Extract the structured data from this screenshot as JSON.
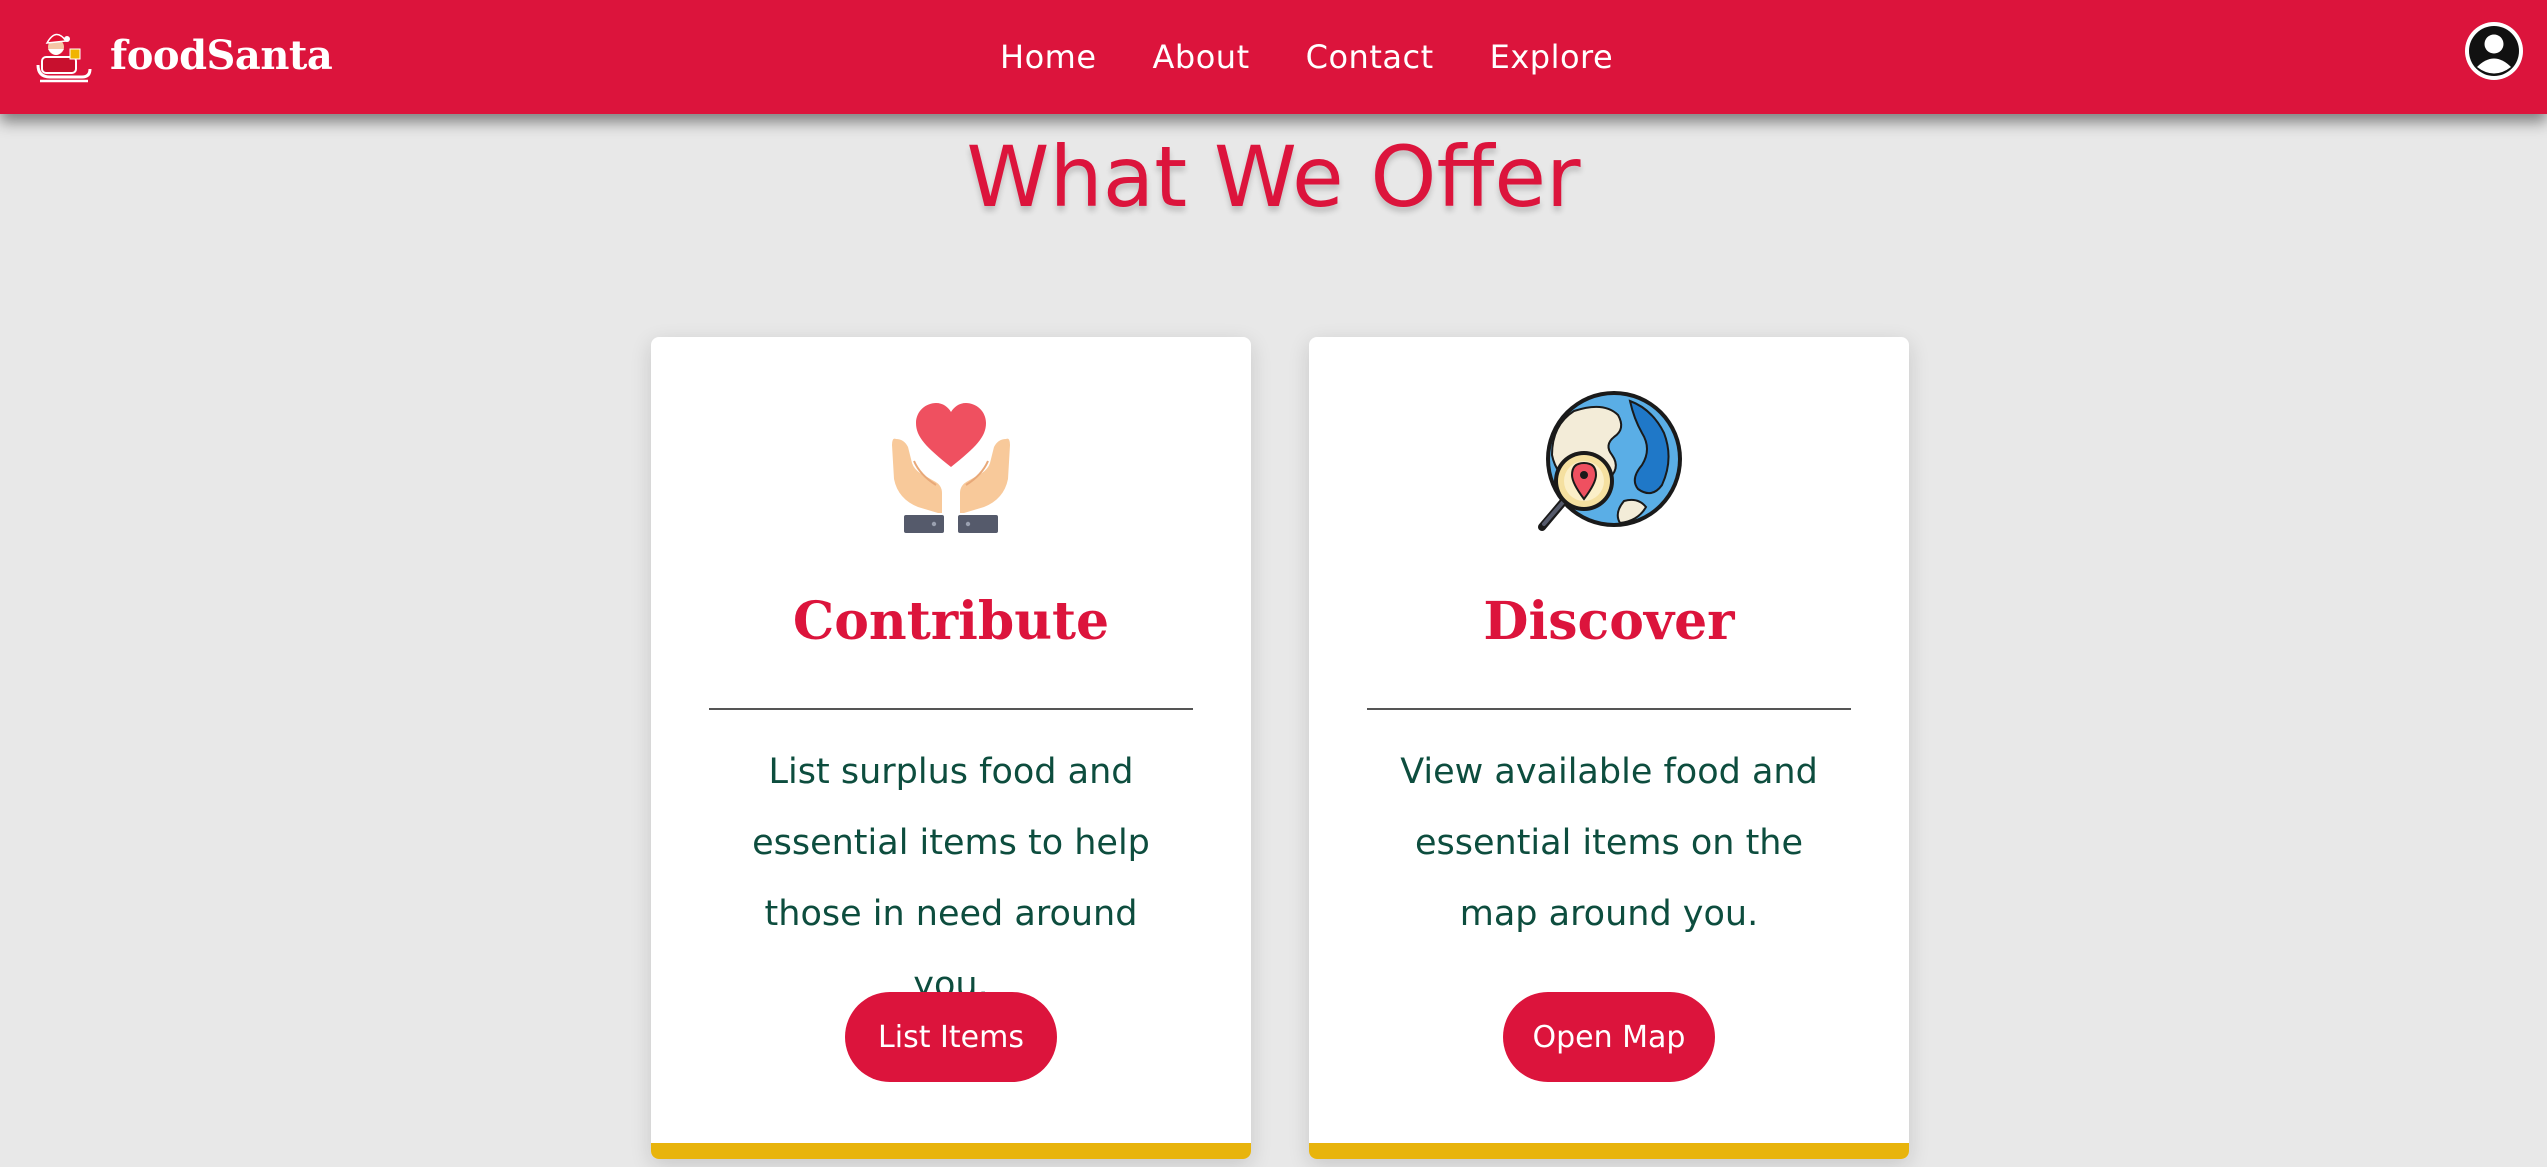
{
  "navbar": {
    "brand_name": "foodSanta",
    "logo_icon": "santa-sleigh-logo",
    "links": [
      "Home",
      "About",
      "Contact",
      "Explore"
    ],
    "profile_icon": "user-circle-icon"
  },
  "main": {
    "title": "What We Offer",
    "cards": [
      {
        "icon": "hands-heart-icon",
        "title": "Contribute",
        "text": "List surplus food and essential items to help those in need around you.",
        "button_label": "List Items"
      },
      {
        "icon": "globe-search-icon",
        "title": "Discover",
        "text": "View available food and essential items on the map around you.",
        "button_label": "Open Map"
      }
    ]
  },
  "colors": {
    "primary": "#dc143c",
    "background": "#e8e8e8",
    "card": "#ffffff",
    "body_text": "#0d4d3e",
    "accent": "#e8b40c"
  }
}
